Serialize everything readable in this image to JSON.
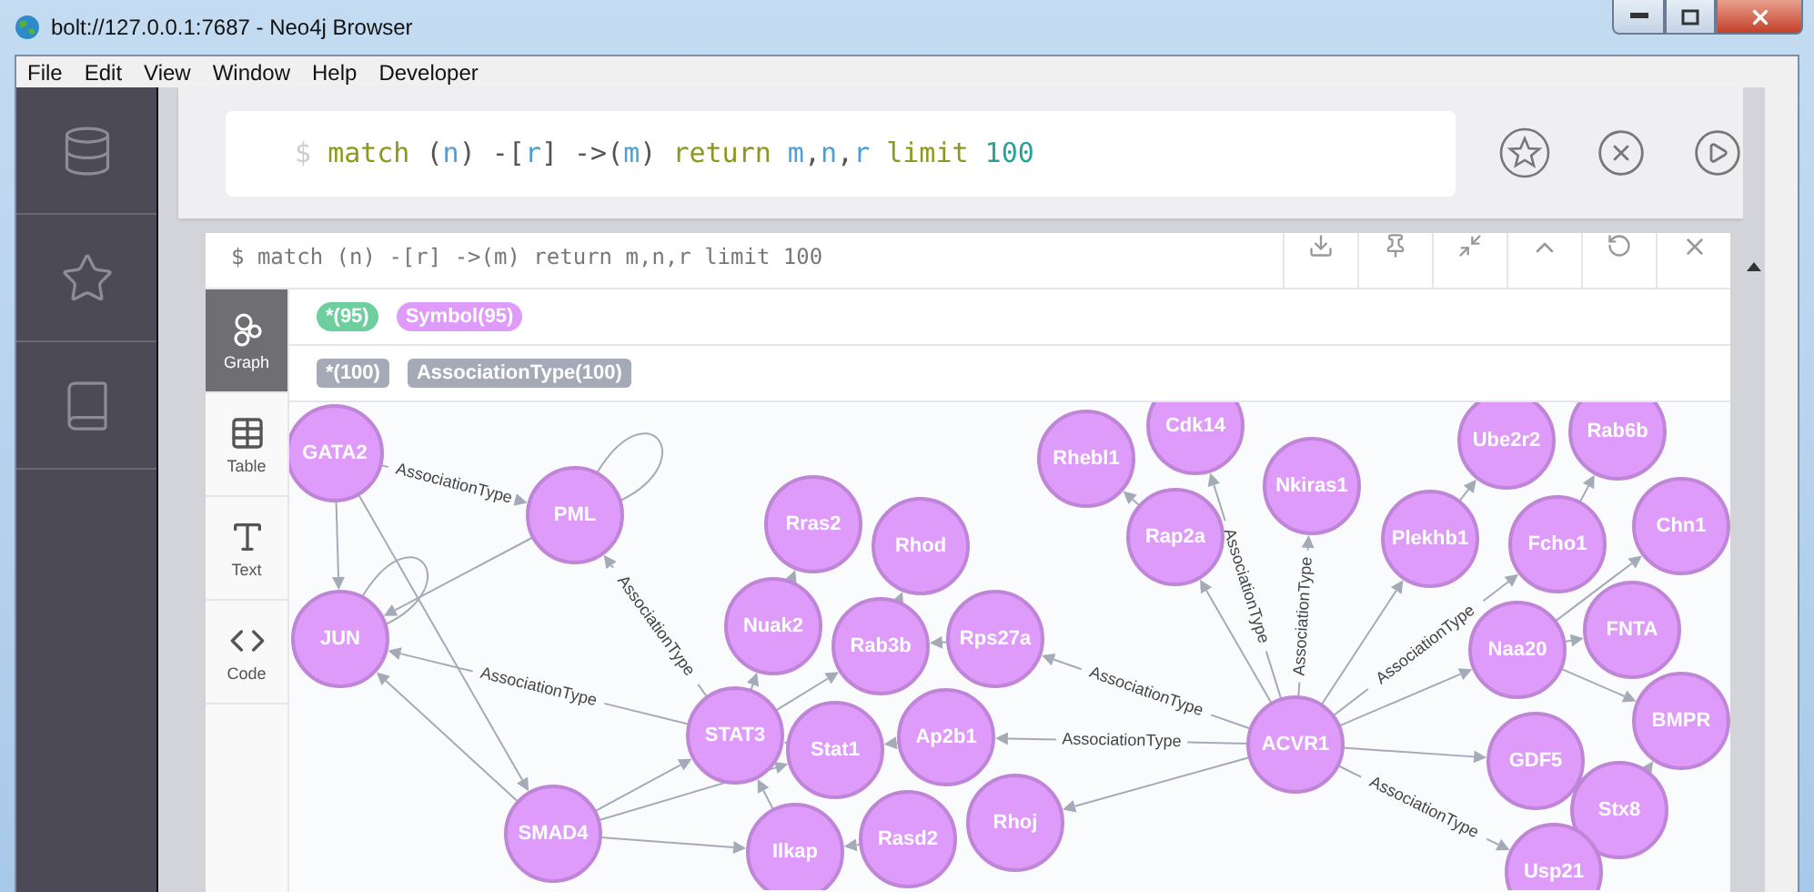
{
  "window": {
    "title": "bolt://127.0.0.1:7687 - Neo4j Browser"
  },
  "menu": [
    "File",
    "Edit",
    "View",
    "Window",
    "Help",
    "Developer"
  ],
  "editor": {
    "prompt": "$",
    "tokens": [
      {
        "text": "match",
        "kind": "keyword"
      },
      {
        "text": " (",
        "kind": "punct"
      },
      {
        "text": "n",
        "kind": "var"
      },
      {
        "text": ") -[",
        "kind": "punct"
      },
      {
        "text": "r",
        "kind": "var"
      },
      {
        "text": "] ->(",
        "kind": "punct"
      },
      {
        "text": "m",
        "kind": "var"
      },
      {
        "text": ") ",
        "kind": "punct"
      },
      {
        "text": "return",
        "kind": "keyword"
      },
      {
        "text": " m",
        "kind": "var"
      },
      {
        "text": ",",
        "kind": "punct"
      },
      {
        "text": "n",
        "kind": "var"
      },
      {
        "text": ",",
        "kind": "punct"
      },
      {
        "text": "r",
        "kind": "var"
      },
      {
        "text": " limit",
        "kind": "keyword"
      },
      {
        "text": " 100",
        "kind": "number"
      }
    ]
  },
  "result": {
    "query": "$ match (n) -[r] ->(m) return m,n,r limit 100",
    "tabs": [
      {
        "label": "Graph",
        "kind": "graph",
        "selected": true
      },
      {
        "label": "Table",
        "kind": "table",
        "selected": false
      },
      {
        "label": "Text",
        "kind": "text",
        "selected": false
      },
      {
        "label": "Code",
        "kind": "code",
        "selected": false
      }
    ],
    "node_labels": [
      {
        "text": "*(95)",
        "color": "#6dce9e"
      },
      {
        "text": "Symbol(95)",
        "color": "#de9bf9"
      }
    ],
    "relationship_types": [
      {
        "text": "*(100)",
        "color": "#a5abb6"
      },
      {
        "text": "AssociationType(100)",
        "color": "#a5abb6"
      }
    ],
    "nodes": [
      "GATA2",
      "PML",
      "JUN",
      "Rras2",
      "Rhod",
      "Nuak2",
      "Rab3b",
      "Rps27a",
      "STAT3",
      "Stat1",
      "Ap2b1",
      "SMAD4",
      "Ilkap",
      "Rasd2",
      "Rhoj",
      "Rhebl1",
      "Cdk14",
      "Rap2a",
      "Nkiras1",
      "Plekhb1",
      "Ube2r2",
      "Rab6b",
      "Fcho1",
      "Chn1",
      "Naa20",
      "FNTA",
      "BMPR",
      "ACVR1",
      "GDF5",
      "Stx8",
      "Usp21"
    ],
    "relationship_labels": [
      "AssociationType",
      "AssociationType",
      "AssociationType",
      "AssociationType",
      "AssociationType",
      "AssociationType",
      "AssociationType",
      "AssociationType",
      "AssociationType"
    ]
  }
}
